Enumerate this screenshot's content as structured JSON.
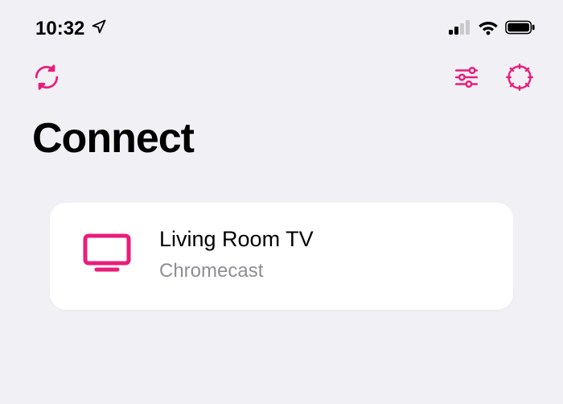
{
  "status": {
    "time": "10:32"
  },
  "page": {
    "title": "Connect"
  },
  "device": {
    "name": "Living Room TV",
    "type": "Chromecast"
  },
  "colors": {
    "accent": "#e91e7a"
  }
}
